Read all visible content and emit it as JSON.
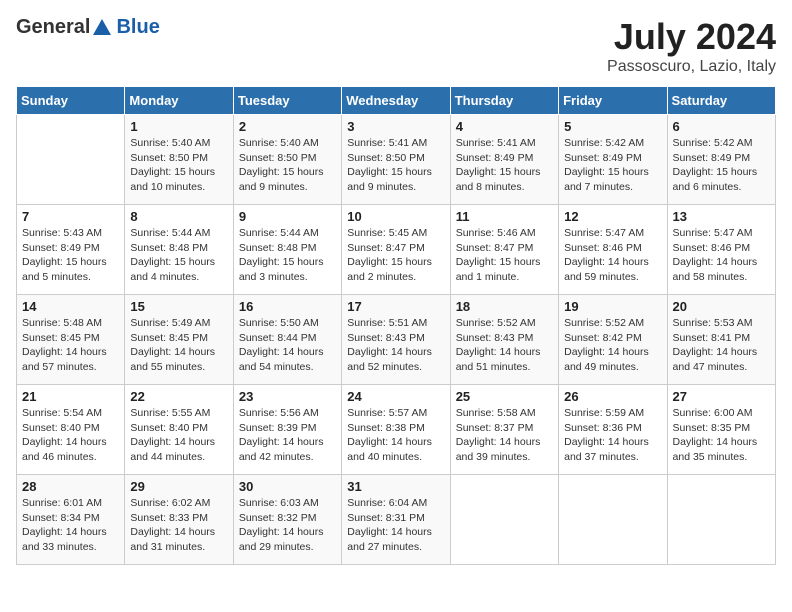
{
  "header": {
    "logo_general": "General",
    "logo_blue": "Blue",
    "month": "July 2024",
    "location": "Passoscuro, Lazio, Italy"
  },
  "days_of_week": [
    "Sunday",
    "Monday",
    "Tuesday",
    "Wednesday",
    "Thursday",
    "Friday",
    "Saturday"
  ],
  "weeks": [
    [
      {
        "day": "",
        "info": ""
      },
      {
        "day": "1",
        "info": "Sunrise: 5:40 AM\nSunset: 8:50 PM\nDaylight: 15 hours\nand 10 minutes."
      },
      {
        "day": "2",
        "info": "Sunrise: 5:40 AM\nSunset: 8:50 PM\nDaylight: 15 hours\nand 9 minutes."
      },
      {
        "day": "3",
        "info": "Sunrise: 5:41 AM\nSunset: 8:50 PM\nDaylight: 15 hours\nand 9 minutes."
      },
      {
        "day": "4",
        "info": "Sunrise: 5:41 AM\nSunset: 8:49 PM\nDaylight: 15 hours\nand 8 minutes."
      },
      {
        "day": "5",
        "info": "Sunrise: 5:42 AM\nSunset: 8:49 PM\nDaylight: 15 hours\nand 7 minutes."
      },
      {
        "day": "6",
        "info": "Sunrise: 5:42 AM\nSunset: 8:49 PM\nDaylight: 15 hours\nand 6 minutes."
      }
    ],
    [
      {
        "day": "7",
        "info": "Sunrise: 5:43 AM\nSunset: 8:49 PM\nDaylight: 15 hours\nand 5 minutes."
      },
      {
        "day": "8",
        "info": "Sunrise: 5:44 AM\nSunset: 8:48 PM\nDaylight: 15 hours\nand 4 minutes."
      },
      {
        "day": "9",
        "info": "Sunrise: 5:44 AM\nSunset: 8:48 PM\nDaylight: 15 hours\nand 3 minutes."
      },
      {
        "day": "10",
        "info": "Sunrise: 5:45 AM\nSunset: 8:47 PM\nDaylight: 15 hours\nand 2 minutes."
      },
      {
        "day": "11",
        "info": "Sunrise: 5:46 AM\nSunset: 8:47 PM\nDaylight: 15 hours\nand 1 minute."
      },
      {
        "day": "12",
        "info": "Sunrise: 5:47 AM\nSunset: 8:46 PM\nDaylight: 14 hours\nand 59 minutes."
      },
      {
        "day": "13",
        "info": "Sunrise: 5:47 AM\nSunset: 8:46 PM\nDaylight: 14 hours\nand 58 minutes."
      }
    ],
    [
      {
        "day": "14",
        "info": "Sunrise: 5:48 AM\nSunset: 8:45 PM\nDaylight: 14 hours\nand 57 minutes."
      },
      {
        "day": "15",
        "info": "Sunrise: 5:49 AM\nSunset: 8:45 PM\nDaylight: 14 hours\nand 55 minutes."
      },
      {
        "day": "16",
        "info": "Sunrise: 5:50 AM\nSunset: 8:44 PM\nDaylight: 14 hours\nand 54 minutes."
      },
      {
        "day": "17",
        "info": "Sunrise: 5:51 AM\nSunset: 8:43 PM\nDaylight: 14 hours\nand 52 minutes."
      },
      {
        "day": "18",
        "info": "Sunrise: 5:52 AM\nSunset: 8:43 PM\nDaylight: 14 hours\nand 51 minutes."
      },
      {
        "day": "19",
        "info": "Sunrise: 5:52 AM\nSunset: 8:42 PM\nDaylight: 14 hours\nand 49 minutes."
      },
      {
        "day": "20",
        "info": "Sunrise: 5:53 AM\nSunset: 8:41 PM\nDaylight: 14 hours\nand 47 minutes."
      }
    ],
    [
      {
        "day": "21",
        "info": "Sunrise: 5:54 AM\nSunset: 8:40 PM\nDaylight: 14 hours\nand 46 minutes."
      },
      {
        "day": "22",
        "info": "Sunrise: 5:55 AM\nSunset: 8:40 PM\nDaylight: 14 hours\nand 44 minutes."
      },
      {
        "day": "23",
        "info": "Sunrise: 5:56 AM\nSunset: 8:39 PM\nDaylight: 14 hours\nand 42 minutes."
      },
      {
        "day": "24",
        "info": "Sunrise: 5:57 AM\nSunset: 8:38 PM\nDaylight: 14 hours\nand 40 minutes."
      },
      {
        "day": "25",
        "info": "Sunrise: 5:58 AM\nSunset: 8:37 PM\nDaylight: 14 hours\nand 39 minutes."
      },
      {
        "day": "26",
        "info": "Sunrise: 5:59 AM\nSunset: 8:36 PM\nDaylight: 14 hours\nand 37 minutes."
      },
      {
        "day": "27",
        "info": "Sunrise: 6:00 AM\nSunset: 8:35 PM\nDaylight: 14 hours\nand 35 minutes."
      }
    ],
    [
      {
        "day": "28",
        "info": "Sunrise: 6:01 AM\nSunset: 8:34 PM\nDaylight: 14 hours\nand 33 minutes."
      },
      {
        "day": "29",
        "info": "Sunrise: 6:02 AM\nSunset: 8:33 PM\nDaylight: 14 hours\nand 31 minutes."
      },
      {
        "day": "30",
        "info": "Sunrise: 6:03 AM\nSunset: 8:32 PM\nDaylight: 14 hours\nand 29 minutes."
      },
      {
        "day": "31",
        "info": "Sunrise: 6:04 AM\nSunset: 8:31 PM\nDaylight: 14 hours\nand 27 minutes."
      },
      {
        "day": "",
        "info": ""
      },
      {
        "day": "",
        "info": ""
      },
      {
        "day": "",
        "info": ""
      }
    ]
  ]
}
